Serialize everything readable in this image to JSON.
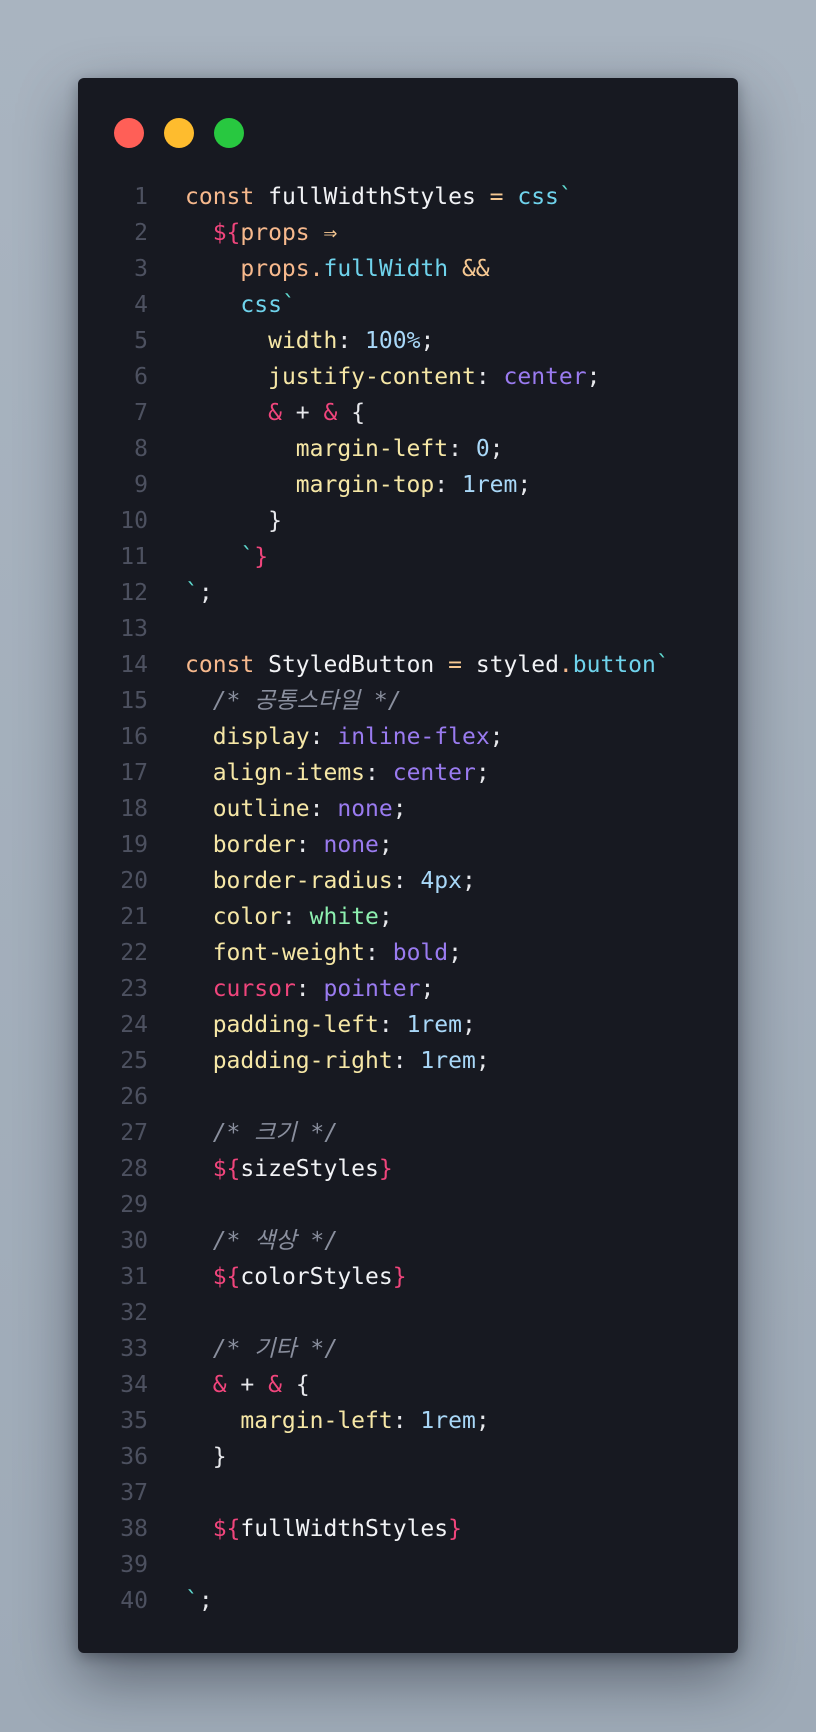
{
  "window": {
    "buttons": [
      {
        "name": "close",
        "color": "#ff5f57"
      },
      {
        "name": "minimize",
        "color": "#febc2e"
      },
      {
        "name": "maximize",
        "color": "#28c840"
      }
    ]
  },
  "code": {
    "language": "javascript",
    "lines": [
      {
        "n": "1",
        "tokens": [
          [
            "kw",
            "const"
          ],
          [
            "id",
            " fullWidthStyles "
          ],
          [
            "op",
            "="
          ],
          [
            "fn",
            " css"
          ],
          [
            "tick",
            "`"
          ]
        ]
      },
      {
        "n": "2",
        "tokens": [
          [
            "pun",
            "  "
          ],
          [
            "dlr",
            "${"
          ],
          [
            "kw",
            "props "
          ],
          [
            "op",
            "⇒"
          ]
        ]
      },
      {
        "n": "3",
        "tokens": [
          [
            "pun",
            "    "
          ],
          [
            "kw",
            "props."
          ],
          [
            "fn",
            "fullWidth"
          ],
          [
            "op",
            " &&"
          ]
        ]
      },
      {
        "n": "4",
        "tokens": [
          [
            "pun",
            "    "
          ],
          [
            "fn",
            "css"
          ],
          [
            "tick",
            "`"
          ]
        ]
      },
      {
        "n": "5",
        "tokens": [
          [
            "pun",
            "      "
          ],
          [
            "prop",
            "width"
          ],
          [
            "pun",
            ": "
          ],
          [
            "num",
            "100%"
          ],
          [
            "pun",
            ";"
          ]
        ]
      },
      {
        "n": "6",
        "tokens": [
          [
            "pun",
            "      "
          ],
          [
            "prop",
            "justify-content"
          ],
          [
            "pun",
            ": "
          ],
          [
            "val",
            "center"
          ],
          [
            "pun",
            ";"
          ]
        ]
      },
      {
        "n": "7",
        "tokens": [
          [
            "pun",
            "      "
          ],
          [
            "amp",
            "&"
          ],
          [
            "pun",
            " + "
          ],
          [
            "amp",
            "&"
          ],
          [
            "pun",
            " {"
          ]
        ]
      },
      {
        "n": "8",
        "tokens": [
          [
            "pun",
            "        "
          ],
          [
            "prop",
            "margin-left"
          ],
          [
            "pun",
            ": "
          ],
          [
            "num",
            "0"
          ],
          [
            "pun",
            ";"
          ]
        ]
      },
      {
        "n": "9",
        "tokens": [
          [
            "pun",
            "        "
          ],
          [
            "prop",
            "margin-top"
          ],
          [
            "pun",
            ": "
          ],
          [
            "num",
            "1rem"
          ],
          [
            "pun",
            ";"
          ]
        ]
      },
      {
        "n": "10",
        "tokens": [
          [
            "pun",
            "      }"
          ]
        ]
      },
      {
        "n": "11",
        "tokens": [
          [
            "pun",
            "    "
          ],
          [
            "tick",
            "`"
          ],
          [
            "red",
            "}"
          ]
        ]
      },
      {
        "n": "12",
        "tokens": [
          [
            "tick",
            "`"
          ],
          [
            "pun",
            ";"
          ]
        ]
      },
      {
        "n": "13",
        "tokens": []
      },
      {
        "n": "14",
        "tokens": [
          [
            "kw",
            "const"
          ],
          [
            "id",
            " StyledButton "
          ],
          [
            "op",
            "="
          ],
          [
            "id",
            " styled"
          ],
          [
            "kw",
            "."
          ],
          [
            "fn",
            "button"
          ],
          [
            "tick",
            "`"
          ]
        ]
      },
      {
        "n": "15",
        "tokens": [
          [
            "pun",
            "  "
          ],
          [
            "cmt",
            "/* 공통스타일 */"
          ]
        ]
      },
      {
        "n": "16",
        "tokens": [
          [
            "pun",
            "  "
          ],
          [
            "prop",
            "display"
          ],
          [
            "pun",
            ": "
          ],
          [
            "val",
            "inline-flex"
          ],
          [
            "pun",
            ";"
          ]
        ]
      },
      {
        "n": "17",
        "tokens": [
          [
            "pun",
            "  "
          ],
          [
            "prop",
            "align-items"
          ],
          [
            "pun",
            ": "
          ],
          [
            "val",
            "center"
          ],
          [
            "pun",
            ";"
          ]
        ]
      },
      {
        "n": "18",
        "tokens": [
          [
            "pun",
            "  "
          ],
          [
            "prop",
            "outline"
          ],
          [
            "pun",
            ": "
          ],
          [
            "val",
            "none"
          ],
          [
            "pun",
            ";"
          ]
        ]
      },
      {
        "n": "19",
        "tokens": [
          [
            "pun",
            "  "
          ],
          [
            "prop",
            "border"
          ],
          [
            "pun",
            ": "
          ],
          [
            "val",
            "none"
          ],
          [
            "pun",
            ";"
          ]
        ]
      },
      {
        "n": "20",
        "tokens": [
          [
            "pun",
            "  "
          ],
          [
            "prop",
            "border-radius"
          ],
          [
            "pun",
            ": "
          ],
          [
            "num",
            "4px"
          ],
          [
            "pun",
            ";"
          ]
        ]
      },
      {
        "n": "21",
        "tokens": [
          [
            "pun",
            "  "
          ],
          [
            "prop",
            "color"
          ],
          [
            "pun",
            ": "
          ],
          [
            "grn",
            "white"
          ],
          [
            "pun",
            ";"
          ]
        ]
      },
      {
        "n": "22",
        "tokens": [
          [
            "pun",
            "  "
          ],
          [
            "prop",
            "font-weight"
          ],
          [
            "pun",
            ": "
          ],
          [
            "val",
            "bold"
          ],
          [
            "pun",
            ";"
          ]
        ]
      },
      {
        "n": "23",
        "tokens": [
          [
            "pun",
            "  "
          ],
          [
            "red",
            "cursor"
          ],
          [
            "pun",
            ": "
          ],
          [
            "val",
            "pointer"
          ],
          [
            "pun",
            ";"
          ]
        ]
      },
      {
        "n": "24",
        "tokens": [
          [
            "pun",
            "  "
          ],
          [
            "prop",
            "padding-left"
          ],
          [
            "pun",
            ": "
          ],
          [
            "num",
            "1rem"
          ],
          [
            "pun",
            ";"
          ]
        ]
      },
      {
        "n": "25",
        "tokens": [
          [
            "pun",
            "  "
          ],
          [
            "prop",
            "padding-right"
          ],
          [
            "pun",
            ": "
          ],
          [
            "num",
            "1rem"
          ],
          [
            "pun",
            ";"
          ]
        ]
      },
      {
        "n": "26",
        "tokens": []
      },
      {
        "n": "27",
        "tokens": [
          [
            "pun",
            "  "
          ],
          [
            "cmt",
            "/* 크기 */"
          ]
        ]
      },
      {
        "n": "28",
        "tokens": [
          [
            "pun",
            "  "
          ],
          [
            "dlr",
            "${"
          ],
          [
            "id",
            "sizeStyles"
          ],
          [
            "red",
            "}"
          ]
        ]
      },
      {
        "n": "29",
        "tokens": []
      },
      {
        "n": "30",
        "tokens": [
          [
            "pun",
            "  "
          ],
          [
            "cmt",
            "/* 색상 */"
          ]
        ]
      },
      {
        "n": "31",
        "tokens": [
          [
            "pun",
            "  "
          ],
          [
            "dlr",
            "${"
          ],
          [
            "id",
            "colorStyles"
          ],
          [
            "red",
            "}"
          ]
        ]
      },
      {
        "n": "32",
        "tokens": []
      },
      {
        "n": "33",
        "tokens": [
          [
            "pun",
            "  "
          ],
          [
            "cmt",
            "/* 기타 */"
          ]
        ]
      },
      {
        "n": "34",
        "tokens": [
          [
            "pun",
            "  "
          ],
          [
            "amp",
            "&"
          ],
          [
            "pun",
            " + "
          ],
          [
            "amp",
            "&"
          ],
          [
            "pun",
            " {"
          ]
        ]
      },
      {
        "n": "35",
        "tokens": [
          [
            "pun",
            "    "
          ],
          [
            "prop",
            "margin-left"
          ],
          [
            "pun",
            ": "
          ],
          [
            "num",
            "1rem"
          ],
          [
            "pun",
            ";"
          ]
        ]
      },
      {
        "n": "36",
        "tokens": [
          [
            "pun",
            "  }"
          ]
        ]
      },
      {
        "n": "37",
        "tokens": []
      },
      {
        "n": "38",
        "tokens": [
          [
            "pun",
            "  "
          ],
          [
            "dlr",
            "${"
          ],
          [
            "id",
            "fullWidthStyles"
          ],
          [
            "red",
            "}"
          ]
        ]
      },
      {
        "n": "39",
        "tokens": []
      },
      {
        "n": "40",
        "tokens": [
          [
            "tick",
            "`"
          ],
          [
            "pun",
            ";"
          ]
        ]
      }
    ]
  }
}
